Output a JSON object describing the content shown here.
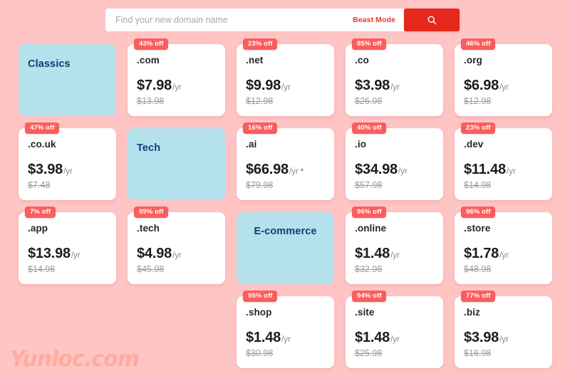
{
  "search": {
    "placeholder": "Find your new domain name",
    "value": "",
    "beast_mode_label": "Beast Mode",
    "button_icon": "search-icon",
    "button_color": "#e5281b",
    "beast_mode_color": "#e8392a"
  },
  "theme": {
    "background": "#ffc4c4",
    "card_background": "#ffffff",
    "category_card_background": "#b4e1ec",
    "category_text": "#183a78",
    "badge_background": "#fb5d5d",
    "badge_text": "#ffffff",
    "price_text": "#1c1c1c",
    "old_price_text": "#9b9b9b"
  },
  "watermark": {
    "text": "Yunloc.com",
    "color": "#ffab9f"
  },
  "cards": [
    {
      "kind": "category",
      "label": "Classics",
      "align": "left"
    },
    {
      "kind": "domain",
      "badge": "43% off",
      "tld": ".com",
      "price": "$7.98",
      "per": "/yr",
      "old_price": "$13.98"
    },
    {
      "kind": "domain",
      "badge": "23% off",
      "tld": ".net",
      "price": "$9.98",
      "per": "/yr",
      "old_price": "$12.98"
    },
    {
      "kind": "domain",
      "badge": "85% off",
      "tld": ".co",
      "price": "$3.98",
      "per": "/yr",
      "old_price": "$26.98"
    },
    {
      "kind": "domain",
      "badge": "46% off",
      "tld": ".org",
      "price": "$6.98",
      "per": "/yr",
      "old_price": "$12.98"
    },
    {
      "kind": "domain",
      "badge": "47% off",
      "tld": ".co.uk",
      "price": "$3.98",
      "per": "/yr",
      "old_price": "$7.48"
    },
    {
      "kind": "category",
      "label": "Tech",
      "align": "left"
    },
    {
      "kind": "domain",
      "badge": "16% off",
      "tld": ".ai",
      "price": "$66.98",
      "per": "/yr",
      "star": "*",
      "old_price": "$79.98"
    },
    {
      "kind": "domain",
      "badge": "40% off",
      "tld": ".io",
      "price": "$34.98",
      "per": "/yr",
      "old_price": "$57.98"
    },
    {
      "kind": "domain",
      "badge": "23% off",
      "tld": ".dev",
      "price": "$11.48",
      "per": "/yr",
      "old_price": "$14.98"
    },
    {
      "kind": "domain",
      "badge": "7% off",
      "tld": ".app",
      "price": "$13.98",
      "per": "/yr",
      "old_price": "$14.98"
    },
    {
      "kind": "domain",
      "badge": "89% off",
      "tld": ".tech",
      "price": "$4.98",
      "per": "/yr",
      "old_price": "$45.98"
    },
    {
      "kind": "category",
      "label": "E-commerce",
      "align": "center"
    },
    {
      "kind": "domain",
      "badge": "96% off",
      "tld": ".online",
      "price": "$1.48",
      "per": "/yr",
      "old_price": "$32.98"
    },
    {
      "kind": "domain",
      "badge": "96% off",
      "tld": ".store",
      "price": "$1.78",
      "per": "/yr",
      "old_price": "$48.98"
    },
    {
      "kind": "empty"
    },
    {
      "kind": "empty"
    },
    {
      "kind": "domain",
      "badge": "95% off",
      "tld": ".shop",
      "price": "$1.48",
      "per": "/yr",
      "old_price": "$30.98"
    },
    {
      "kind": "domain",
      "badge": "94% off",
      "tld": ".site",
      "price": "$1.48",
      "per": "/yr",
      "old_price": "$25.98"
    },
    {
      "kind": "domain",
      "badge": "77% off",
      "tld": ".biz",
      "price": "$3.98",
      "per": "/yr",
      "old_price": "$16.98"
    }
  ]
}
